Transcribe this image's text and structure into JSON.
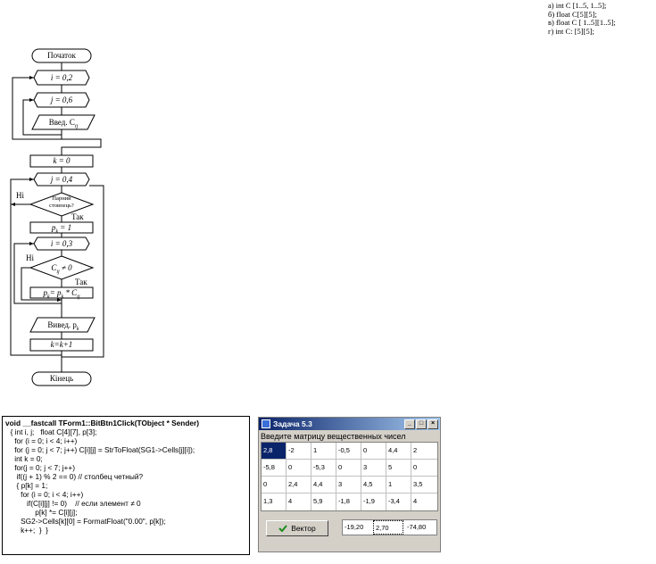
{
  "options": [
    "а) int C [1..5, 1..5];",
    "б) float C[5][5];",
    "в) float C [ 1..5][1..5];",
    "г) int C: [5][5];"
  ],
  "flowchart": {
    "start": "Початок",
    "loop_i1": "i = 0,2",
    "loop_j1": "j = 0,6",
    "input": "Введ. C",
    "input_sub": "ij",
    "assign_k": "k = 0",
    "loop_j2": "j = 0,4",
    "decision_even_1": "Парний",
    "decision_even_2": "стовпець?",
    "no_1": "Ні",
    "yes_1": "Так",
    "assign_p": "p",
    "assign_p_sub": "k",
    "assign_p_rhs": " = 1",
    "loop_i2": "i = 0,3",
    "no_2": "Ні",
    "decision_c": "C",
    "decision_c_sub": "ij",
    "decision_c_rhs": " ≠ 0",
    "yes_2": "Так",
    "mult": "p",
    "mult_sub": "k",
    "mult_rhs": "= p",
    "mult_sub2": "k",
    "mult_tail": " * C",
    "mult_sub3": "ij",
    "output": "Вивед. p",
    "output_sub": "k",
    "incr_k": "k=k+1",
    "end": "Кінець"
  },
  "code": {
    "header": "void __fastcall TForm1::BitBtn1Click(TObject * Sender)",
    "lines": [
      "  { int i, j;   float C[4][7], p[3];",
      "    for (i = 0; i < 4; i++)",
      "    for (j = 0; j < 7; j++) C[i][j] = StrToFloat(SG1->Cells[j][i]);",
      "    int k = 0;",
      "    for(j = 0; j < 7; j++)",
      "     if((j + 1) % 2 == 0) // столбец четный?",
      "     { p[k] = 1;",
      "       for (i = 0; i < 4; i++)",
      "          if(C[i][j] != 0)    // если элемент ≠ 0",
      "              p[k] *= C[i][j];",
      "       SG2->Cells[k][0] = FormatFloat(\"0.00\", p[k]);",
      "       k++;  }  }"
    ]
  },
  "window": {
    "title": "Задача 5.3",
    "min_glyph": "_",
    "max_glyph": "□",
    "close_glyph": "×",
    "prompt": "Введите матрицу вещественных чисел",
    "grid": [
      [
        "2,8",
        "-2",
        "1",
        "-0,5",
        "0",
        "4,4",
        "2"
      ],
      [
        "-5,8",
        "0",
        "-5,3",
        "0",
        "3",
        "5",
        "0"
      ],
      [
        "0",
        "2,4",
        "4,4",
        "3",
        "4,5",
        "1",
        "3,5"
      ],
      [
        "1,3",
        "4",
        "5,9",
        "-1,8",
        "-1,9",
        "-3,4",
        "4"
      ]
    ],
    "button_label": "Вектор",
    "result": [
      "-19,20",
      "2,70",
      "-74,80"
    ]
  }
}
